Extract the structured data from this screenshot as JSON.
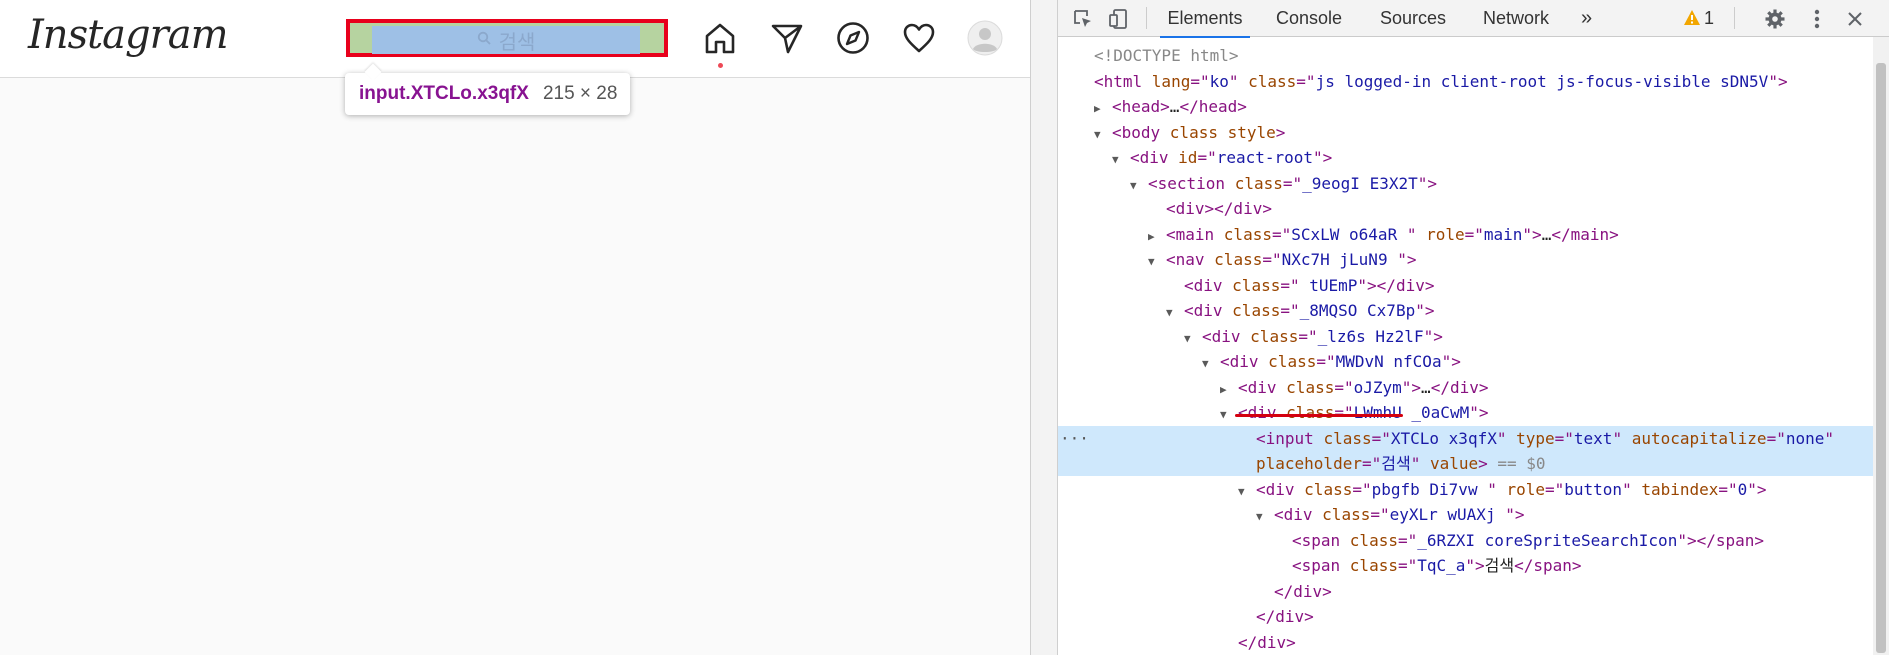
{
  "page": {
    "logo": "Instagram",
    "search_placeholder": "검색",
    "tooltip": {
      "selector": "input.XTCLo.x3qfX",
      "size": "215 × 28"
    }
  },
  "icons": {
    "search": "search-icon",
    "home": "home-icon",
    "direct": "paper-plane-icon",
    "explore": "compass-icon",
    "activity": "heart-icon",
    "profile": "avatar-icon"
  },
  "devtools": {
    "tabs": [
      "Elements",
      "Console",
      "Sources",
      "Network"
    ],
    "more_tabs": "»",
    "warning_count": "1"
  },
  "dom_tree": [
    {
      "indent": 0,
      "toggle": "",
      "parts": [
        [
          "doctype",
          "<!DOCTYPE html>"
        ]
      ]
    },
    {
      "indent": 0,
      "toggle": "",
      "parts": [
        [
          "tag",
          "<html "
        ],
        [
          "attr",
          "lang"
        ],
        [
          "tag",
          "=\""
        ],
        [
          "val",
          "ko"
        ],
        [
          "tag",
          "\" "
        ],
        [
          "attr",
          "class"
        ],
        [
          "tag",
          "=\""
        ],
        [
          "val",
          "js logged-in client-root js-focus-visible sDN5V"
        ],
        [
          "tag",
          "\">"
        ]
      ]
    },
    {
      "indent": 1,
      "toggle": "▶",
      "parts": [
        [
          "tag",
          "<head>"
        ],
        [
          "txt",
          "…"
        ],
        [
          "tag",
          "</head>"
        ]
      ]
    },
    {
      "indent": 1,
      "toggle": "▼",
      "parts": [
        [
          "tag",
          "<body "
        ],
        [
          "attr",
          "class style"
        ],
        [
          "tag",
          ">"
        ]
      ]
    },
    {
      "indent": 2,
      "toggle": "▼",
      "parts": [
        [
          "tag",
          "<div "
        ],
        [
          "attr",
          "id"
        ],
        [
          "tag",
          "=\""
        ],
        [
          "val",
          "react-root"
        ],
        [
          "tag",
          "\">"
        ]
      ]
    },
    {
      "indent": 3,
      "toggle": "▼",
      "parts": [
        [
          "tag",
          "<section "
        ],
        [
          "attr",
          "class"
        ],
        [
          "tag",
          "=\""
        ],
        [
          "val",
          "_9eogI E3X2T"
        ],
        [
          "tag",
          "\">"
        ]
      ]
    },
    {
      "indent": 4,
      "toggle": "",
      "parts": [
        [
          "tag",
          "<div></div>"
        ]
      ]
    },
    {
      "indent": 4,
      "toggle": "▶",
      "parts": [
        [
          "tag",
          "<main "
        ],
        [
          "attr",
          "class"
        ],
        [
          "tag",
          "=\""
        ],
        [
          "val",
          "SCxLW  o64aR "
        ],
        [
          "tag",
          "\" "
        ],
        [
          "attr",
          "role"
        ],
        [
          "tag",
          "=\""
        ],
        [
          "val",
          "main"
        ],
        [
          "tag",
          "\">"
        ],
        [
          "txt",
          "…"
        ],
        [
          "tag",
          "</main>"
        ]
      ]
    },
    {
      "indent": 4,
      "toggle": "▼",
      "parts": [
        [
          "tag",
          "<nav "
        ],
        [
          "attr",
          "class"
        ],
        [
          "tag",
          "=\""
        ],
        [
          "val",
          "NXc7H jLuN9  "
        ],
        [
          "tag",
          "\">"
        ]
      ]
    },
    {
      "indent": 5,
      "toggle": "",
      "parts": [
        [
          "tag",
          "<div "
        ],
        [
          "attr",
          "class"
        ],
        [
          "tag",
          "=\""
        ],
        [
          "val",
          "  tUEmP"
        ],
        [
          "tag",
          "\"></div>"
        ]
      ]
    },
    {
      "indent": 5,
      "toggle": "▼",
      "parts": [
        [
          "tag",
          "<div "
        ],
        [
          "attr",
          "class"
        ],
        [
          "tag",
          "=\""
        ],
        [
          "val",
          "_8MQSO  Cx7Bp"
        ],
        [
          "tag",
          "\">"
        ]
      ]
    },
    {
      "indent": 6,
      "toggle": "▼",
      "parts": [
        [
          "tag",
          "<div "
        ],
        [
          "attr",
          "class"
        ],
        [
          "tag",
          "=\""
        ],
        [
          "val",
          "_lz6s Hz2lF"
        ],
        [
          "tag",
          "\">"
        ]
      ]
    },
    {
      "indent": 7,
      "toggle": "▼",
      "parts": [
        [
          "tag",
          "<div "
        ],
        [
          "attr",
          "class"
        ],
        [
          "tag",
          "=\""
        ],
        [
          "val",
          "MWDvN nfCOa"
        ],
        [
          "tag",
          "\">"
        ]
      ]
    },
    {
      "indent": 8,
      "toggle": "▶",
      "parts": [
        [
          "tag",
          "<div "
        ],
        [
          "attr",
          "class"
        ],
        [
          "tag",
          "=\""
        ],
        [
          "val",
          "oJZym"
        ],
        [
          "tag",
          "\">"
        ],
        [
          "txt",
          "…"
        ],
        [
          "tag",
          "</div>"
        ]
      ]
    },
    {
      "indent": 8,
      "toggle": "▼",
      "parts": [
        [
          "tag",
          "<div "
        ],
        [
          "attr",
          "class"
        ],
        [
          "tag",
          "=\""
        ],
        [
          "val",
          "LWmhU _0aCwM"
        ],
        [
          "tag",
          "\">"
        ]
      ]
    },
    {
      "indent": 9,
      "toggle": "",
      "selected": true,
      "parts": [
        [
          "tag",
          "<input "
        ],
        [
          "attr",
          "class"
        ],
        [
          "tag",
          "=\""
        ],
        [
          "val",
          "XTCLo x3qfX"
        ],
        [
          "tag",
          "\" "
        ],
        [
          "attr",
          "type"
        ],
        [
          "tag",
          "=\""
        ],
        [
          "val",
          "text"
        ],
        [
          "tag",
          "\" "
        ],
        [
          "attr",
          "autocapitalize"
        ],
        [
          "tag",
          "=\""
        ],
        [
          "val",
          "none"
        ],
        [
          "tag",
          "\""
        ]
      ]
    },
    {
      "indent": 9,
      "toggle": "",
      "selected": true,
      "parts": [
        [
          "attr",
          "placeholder"
        ],
        [
          "tag",
          "=\""
        ],
        [
          "val",
          "검색"
        ],
        [
          "tag",
          "\" "
        ],
        [
          "attr",
          "value"
        ],
        [
          "tag",
          ">"
        ],
        [
          "dollar",
          " == $0"
        ]
      ]
    },
    {
      "indent": 9,
      "toggle": "▼",
      "parts": [
        [
          "tag",
          "<div "
        ],
        [
          "attr",
          "class"
        ],
        [
          "tag",
          "=\""
        ],
        [
          "val",
          "pbgfb Di7vw "
        ],
        [
          "tag",
          "\" "
        ],
        [
          "attr",
          "role"
        ],
        [
          "tag",
          "=\""
        ],
        [
          "val",
          "button"
        ],
        [
          "tag",
          "\" "
        ],
        [
          "attr",
          "tabindex"
        ],
        [
          "tag",
          "=\""
        ],
        [
          "val",
          "0"
        ],
        [
          "tag",
          "\">"
        ]
      ]
    },
    {
      "indent": 10,
      "toggle": "▼",
      "parts": [
        [
          "tag",
          "<div "
        ],
        [
          "attr",
          "class"
        ],
        [
          "tag",
          "=\""
        ],
        [
          "val",
          "eyXLr wUAXj "
        ],
        [
          "tag",
          "\">"
        ]
      ]
    },
    {
      "indent": 11,
      "toggle": "",
      "parts": [
        [
          "tag",
          "<span "
        ],
        [
          "attr",
          "class"
        ],
        [
          "tag",
          "=\""
        ],
        [
          "val",
          "_6RZXI coreSpriteSearchIcon"
        ],
        [
          "tag",
          "\"></span>"
        ]
      ]
    },
    {
      "indent": 11,
      "toggle": "",
      "parts": [
        [
          "tag",
          "<span "
        ],
        [
          "attr",
          "class"
        ],
        [
          "tag",
          "=\""
        ],
        [
          "val",
          "TqC_a"
        ],
        [
          "tag",
          "\">"
        ],
        [
          "txt",
          "검색"
        ],
        [
          "tag",
          "</span>"
        ]
      ]
    },
    {
      "indent": 10,
      "toggle": "",
      "parts": [
        [
          "tag",
          "</div>"
        ]
      ]
    },
    {
      "indent": 9,
      "toggle": "",
      "parts": [
        [
          "tag",
          "</div>"
        ]
      ]
    },
    {
      "indent": 8,
      "toggle": "",
      "parts": [
        [
          "tag",
          "</div>"
        ]
      ]
    }
  ]
}
